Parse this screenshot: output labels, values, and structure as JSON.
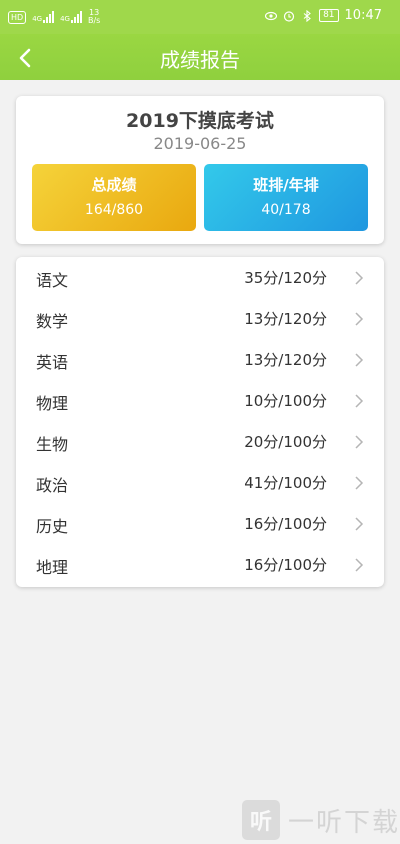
{
  "status_bar": {
    "hd_badge": "HD",
    "net1": "4G",
    "net2": "4G",
    "speed_value": "13",
    "speed_unit": "B/s",
    "battery": "81",
    "time": "10:47"
  },
  "header": {
    "title": "成绩报告",
    "back_icon": "back-arrow-icon"
  },
  "summary": {
    "exam_title": "2019下摸底考试",
    "exam_date": "2019-06-25",
    "total_label": "总成绩",
    "total_value": "164/860",
    "rank_label": "班排/年排",
    "rank_value": "40/178"
  },
  "subjects": [
    {
      "name": "语文",
      "score": "35分/120分"
    },
    {
      "name": "数学",
      "score": "13分/120分"
    },
    {
      "name": "英语",
      "score": "13分/120分"
    },
    {
      "name": "物理",
      "score": "10分/100分"
    },
    {
      "name": "生物",
      "score": "20分/100分"
    },
    {
      "name": "政治",
      "score": "41分/100分"
    },
    {
      "name": "历史",
      "score": "16分/100分"
    },
    {
      "name": "地理",
      "score": "16分/100分"
    }
  ],
  "watermark": {
    "logo_char": "听",
    "text": "一听下载"
  },
  "colors": {
    "accent": "#9fd84b",
    "total_gradient": [
      "#f5d33a",
      "#e9a80f"
    ],
    "rank_gradient": [
      "#33c9ea",
      "#1f97e0"
    ]
  }
}
